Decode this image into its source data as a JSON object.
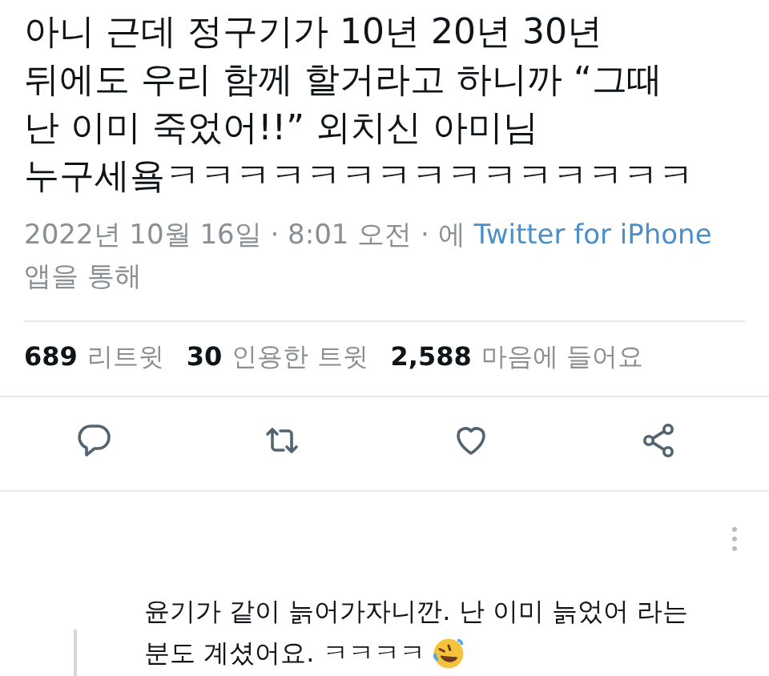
{
  "tweet": {
    "text_lines": [
      "아니 근데 정구기가 10년 20년 30년",
      "뒤에도 우리 함께 할거라고 하니까 “그때",
      "난 이미 죽었어!!” 외치신 아미님",
      "누구세욬ㅋㅋㅋㅋㅋㅋㅋㅋㅋㅋㅋㅋㅋㅋㅋ"
    ],
    "meta": {
      "date": "2022년 10월 16일 · 8:01 오전 · 에",
      "source": "Twitter for iPhone",
      "suffix": "앱을 통해"
    },
    "stats": [
      {
        "count": "689",
        "label": "리트윗"
      },
      {
        "count": "30",
        "label": "인용한 트윗"
      },
      {
        "count": "2,588",
        "label": "마음에 들어요"
      }
    ],
    "actions": [
      {
        "kind": "reply"
      },
      {
        "kind": "retweet"
      },
      {
        "kind": "like"
      },
      {
        "kind": "share"
      }
    ]
  },
  "reply": {
    "text_lines": [
      "윤기가 같이 늙어가자니깐. 난 이미 늙었어 라는",
      "분도 계셨어요. ㅋㅋㅋㅋ"
    ]
  }
}
